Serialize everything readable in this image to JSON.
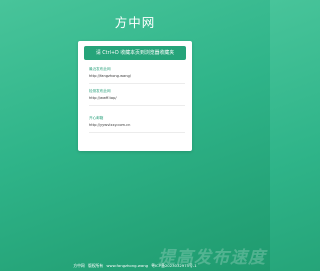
{
  "page": {
    "title": "方中网"
  },
  "card": {
    "bookmark_button": "请 Ctrl+D 收藏本页到浏览器收藏夹",
    "entries": [
      {
        "label": "最近发布此网",
        "url": "http://fangzhong.wang/"
      },
      {
        "label": "检测发布此网",
        "url": "http://wwff.top/"
      },
      {
        "label": "开心邮箱",
        "url": "http://yywvlxxy.com.cn"
      }
    ]
  },
  "footer": {
    "brand": "方中网",
    "copyright": "版权所有",
    "domain": "www.fangzhong.wang",
    "icp": "粤ICP备2023032975号-1"
  },
  "watermark": {
    "text": "提高发布速度"
  },
  "colors": {
    "background_start": "#48c49a",
    "background_end": "#1f9a6e",
    "button": "#26a47a",
    "link_label": "#2fa37f"
  }
}
